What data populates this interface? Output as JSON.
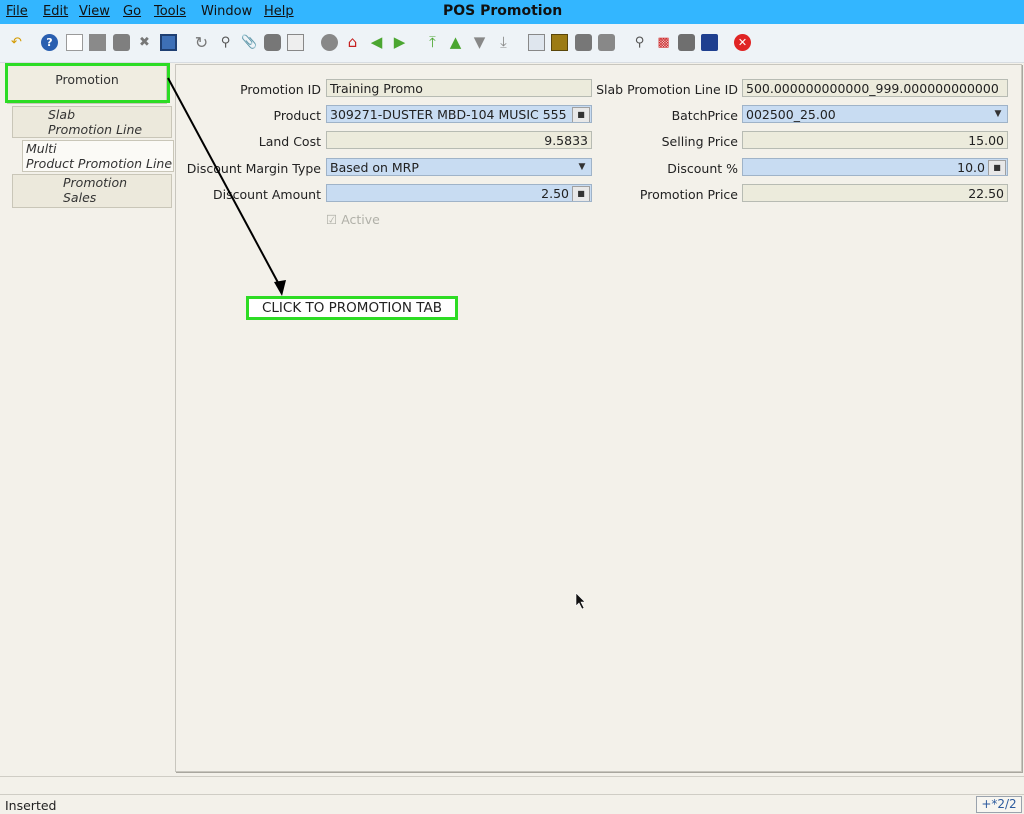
{
  "window": {
    "title": "POS Promotion"
  },
  "menu": [
    "File",
    "Edit",
    "View",
    "Go",
    "Tools",
    "Window",
    "Help"
  ],
  "tabs": {
    "promotion": "Promotion",
    "slab_1": "Slab",
    "slab_2": "Promotion Line",
    "multi_1": "Multi",
    "multi_2": "Product Promotion Line",
    "sales_1": "Promotion",
    "sales_2": "Sales"
  },
  "form": {
    "promotion_id_label": "Promotion ID",
    "promotion_id": "Training Promo",
    "slab_line_id_label": "Slab Promotion Line ID",
    "slab_line_id": "500.000000000000_999.000000000000",
    "product_label": "Product",
    "product": "309271-DUSTER MBD-104 MUSIC 555",
    "batch_price_label": "BatchPrice",
    "batch_price": "002500_25.00",
    "land_cost_label": "Land Cost",
    "land_cost": "9.5833",
    "selling_price_label": "Selling Price",
    "selling_price": "15.00",
    "discount_margin_type_label": "Discount Margin Type",
    "discount_margin_type": "Based on MRP",
    "discount_pct_label": "Discount %",
    "discount_pct": "10.0",
    "discount_amount_label": "Discount Amount",
    "discount_amount": "2.50",
    "promotion_price_label": "Promotion Price",
    "promotion_price": "22.50",
    "active_label": "Active"
  },
  "annotation": {
    "text": "CLICK TO PROMOTION TAB",
    "color": "#2ddc24"
  },
  "status": {
    "text": "Inserted",
    "record_count": "+*2/2"
  },
  "colors": {
    "menubar": "#33b6ff",
    "editable_field": "#c8dcf2",
    "readonly_field": "#ecebdc"
  },
  "toolbar_icons": [
    "undo-icon",
    "help-icon",
    "new-icon",
    "copy-icon",
    "delete-icon",
    "delete-selection-icon",
    "save-icon",
    "refresh-icon",
    "find-icon",
    "attachment-icon",
    "chat-icon",
    "grid-toggle-icon",
    "history-icon",
    "home-icon",
    "back-icon",
    "forward-icon",
    "first-record-icon",
    "previous-record-icon",
    "next-record-icon",
    "last-record-icon",
    "report-icon",
    "archive-icon",
    "print-preview-icon",
    "print-icon",
    "zoom-across-icon",
    "workflow-icon",
    "request-icon",
    "product-info-icon",
    "exit-icon"
  ]
}
